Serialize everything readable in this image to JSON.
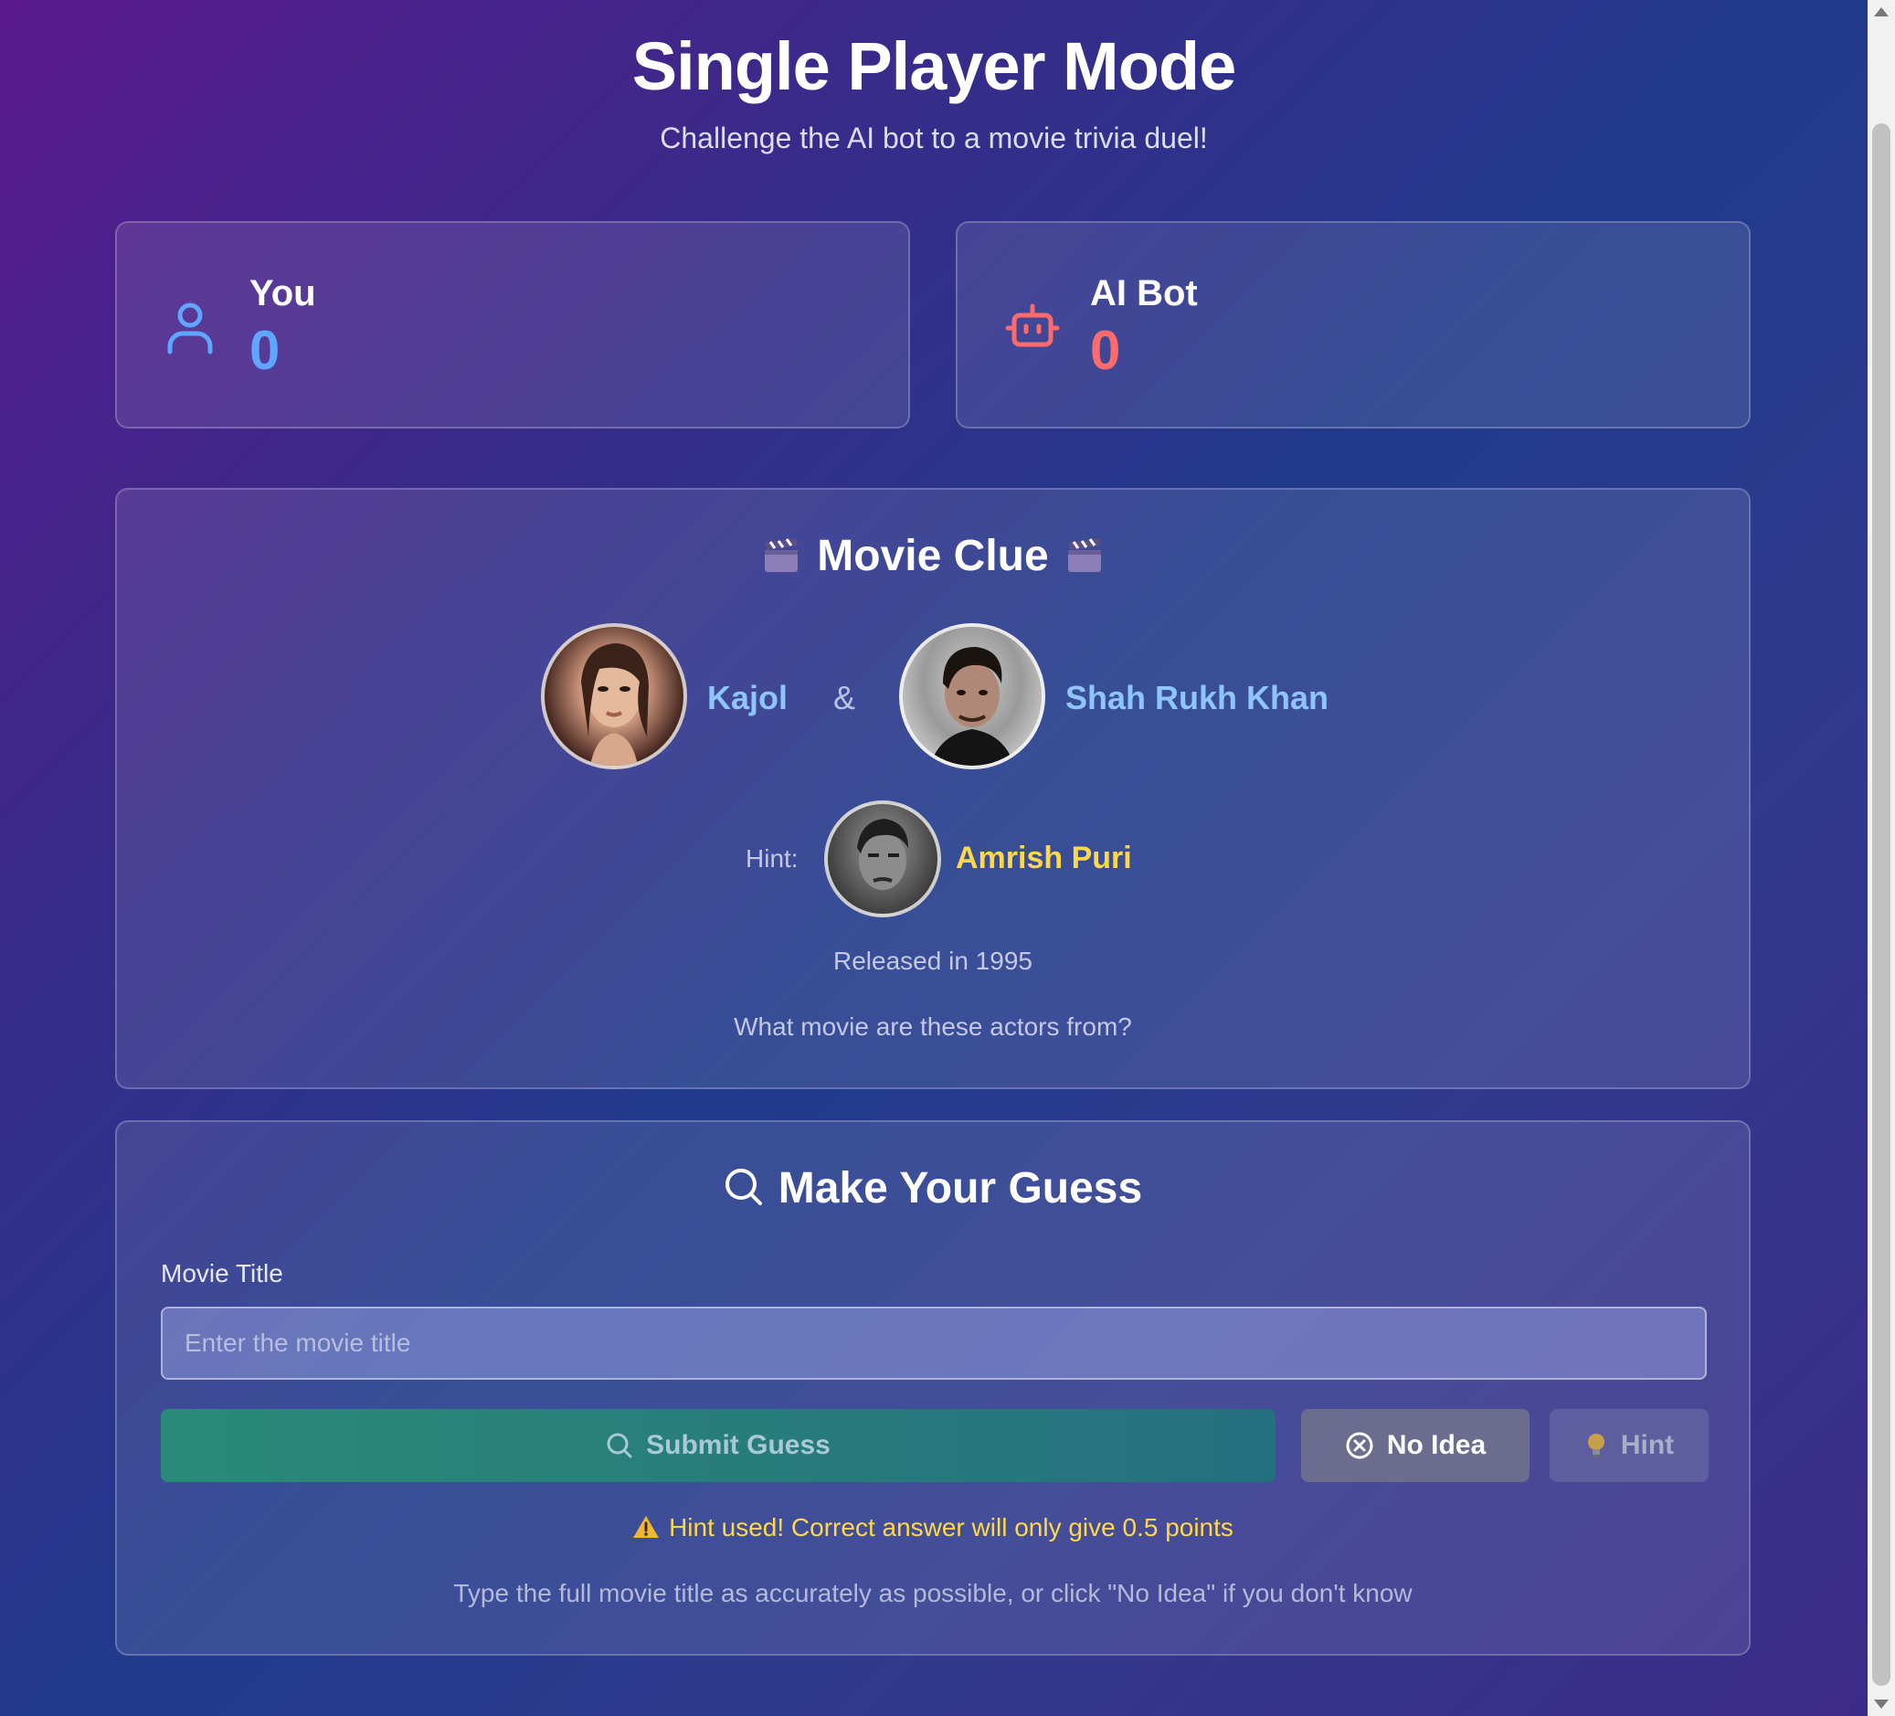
{
  "header": {
    "title": "Single Player Mode",
    "subtitle": "Challenge the AI bot to a movie trivia duel!"
  },
  "scores": {
    "you": {
      "label": "You",
      "value": "0",
      "icon": "user-icon"
    },
    "bot": {
      "label": "AI Bot",
      "value": "0",
      "icon": "bot-icon"
    }
  },
  "clue": {
    "title": "Movie Clue",
    "icon": "clapperboard-icon",
    "actors": [
      {
        "name": "Kajol"
      },
      {
        "name": "Shah Rukh Khan"
      }
    ],
    "separator": "&",
    "hint_label": "Hint:",
    "hint_actor": "Amrish Puri",
    "release": "Released in 1995",
    "question": "What movie are these actors from?"
  },
  "guess": {
    "title": "Make Your Guess",
    "field_label": "Movie Title",
    "input_value": "",
    "input_placeholder": "Enter the movie title",
    "submit_label": "Submit Guess",
    "noidea_label": "No Idea",
    "hint_label": "Hint",
    "warning": "Hint used! Correct answer will only give 0.5 points",
    "instruction": "Type the full movie title as accurately as possible, or click \"No Idea\" if you don't know"
  },
  "colors": {
    "you_score": "#5ea6ff",
    "bot_score": "#ff6b6b",
    "actor_name": "#8ec5ff",
    "hint_name": "#ffd84a",
    "submit_bg": "#2a8a78"
  }
}
